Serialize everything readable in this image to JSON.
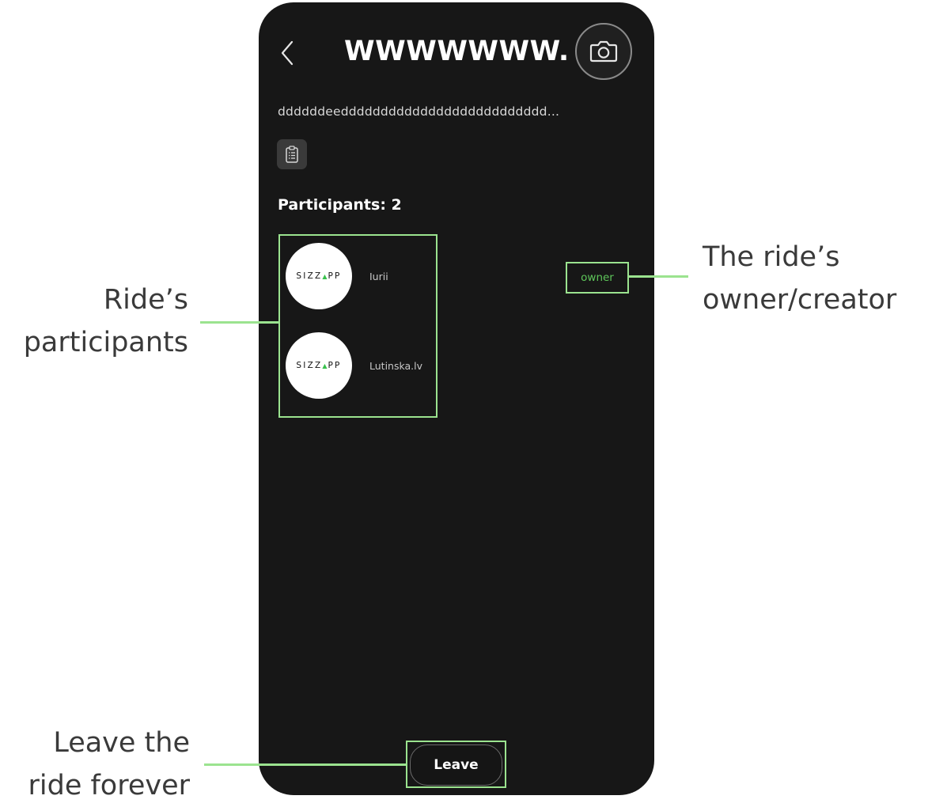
{
  "ride": {
    "title": "WWWWWWW...",
    "description": "ddddddeedddddddddddddddddddddddddd...",
    "participants_label": "Participants: 2"
  },
  "participants": [
    {
      "name": "Iurii",
      "avatar_logo": "SIZZ",
      "avatar_logo_end": "PP",
      "role": "owner"
    },
    {
      "name": "Lutinska.lv",
      "avatar_logo": "SIZZ",
      "avatar_logo_end": "PP"
    }
  ],
  "owner_badge": "owner",
  "leave_button": "Leave",
  "annotations": {
    "participants_line1": "Ride’s",
    "participants_line2": "participants",
    "owner_line1": "The ride’s",
    "owner_line2": "owner/creator",
    "leave_line1": "Leave the",
    "leave_line2": "ride forever"
  },
  "colors": {
    "phone_background": "#171717",
    "accent_green": "#9be38f",
    "badge_text_green": "#5ec65a",
    "logo_arrow_green": "#38c14c"
  },
  "icons": [
    "chevron-left-icon",
    "camera-icon",
    "clipboard-icon"
  ]
}
